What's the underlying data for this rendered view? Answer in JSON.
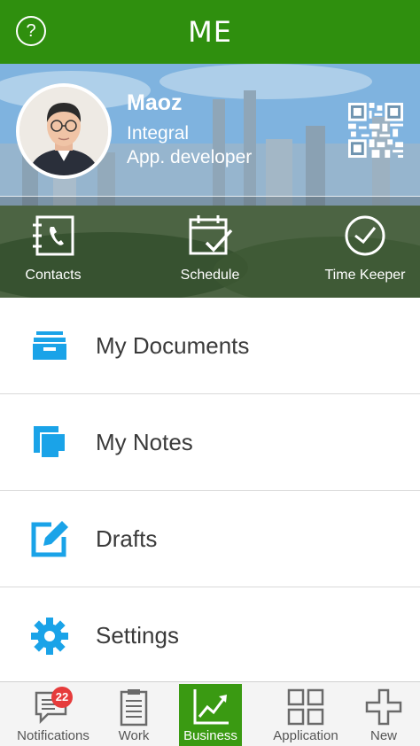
{
  "header": {
    "title": "ME",
    "help_icon": "question-circle-icon",
    "background_color": "#2f8f0e"
  },
  "profile": {
    "name": "Maoz",
    "company": "Integral",
    "role": "App. developer",
    "qr_icon": "qr-code-icon"
  },
  "quick_actions": [
    {
      "label": "Contacts",
      "icon": "contacts-book-icon"
    },
    {
      "label": "Schedule",
      "icon": "calendar-check-icon"
    },
    {
      "label": "Time Keeper",
      "icon": "clock-icon"
    }
  ],
  "menu": {
    "accent_color": "#1aa3e8",
    "items": [
      {
        "label": "My Documents",
        "icon": "file-drawer-icon"
      },
      {
        "label": "My Notes",
        "icon": "notes-icon"
      },
      {
        "label": "Drafts",
        "icon": "edit-icon"
      },
      {
        "label": "Settings",
        "icon": "gear-icon"
      }
    ]
  },
  "tabbar": {
    "active_color": "#3a9a12",
    "tabs": [
      {
        "label": "Notifications",
        "icon": "chat-icon",
        "badge": "22"
      },
      {
        "label": "Work",
        "icon": "clipboard-icon"
      },
      {
        "label": "Business",
        "icon": "trend-chart-icon",
        "active": true
      },
      {
        "label": "Application",
        "icon": "grid-icon"
      },
      {
        "label": "New",
        "icon": "plus-icon"
      }
    ]
  }
}
